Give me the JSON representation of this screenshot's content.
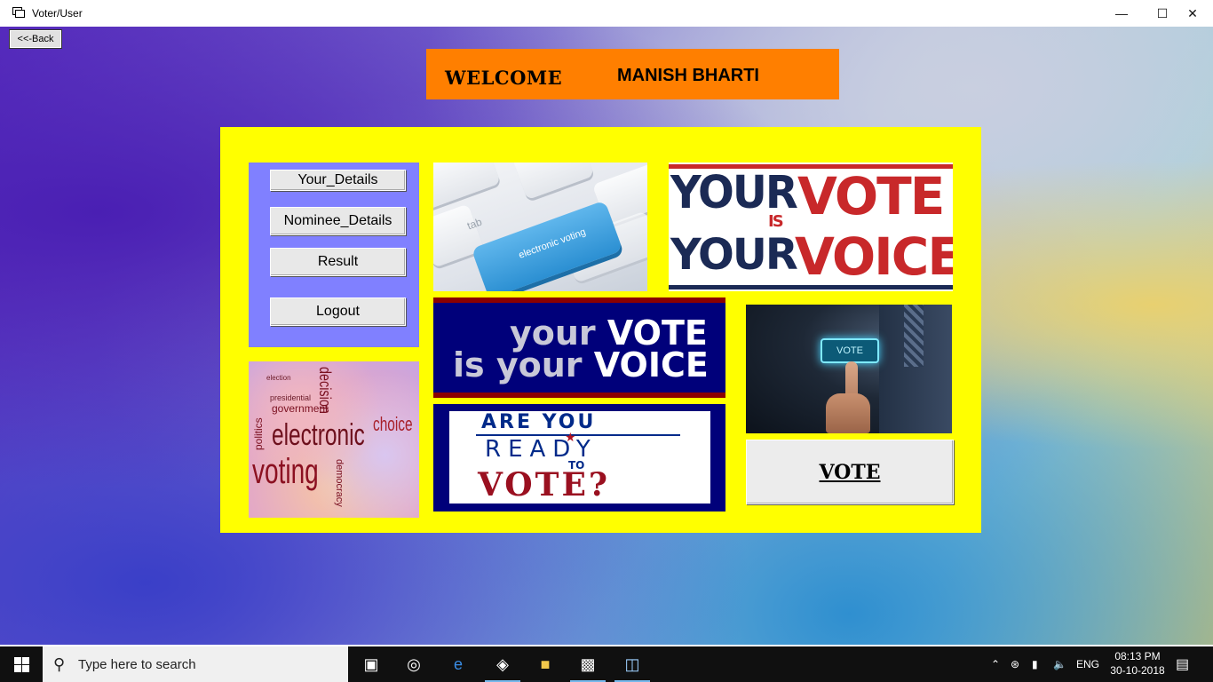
{
  "window": {
    "title": "Voter/User"
  },
  "back_button": {
    "label": "<<-Back"
  },
  "welcome": {
    "word": "WELCOME",
    "name": "MANISH BHARTI"
  },
  "menu": {
    "items": [
      {
        "label": "Your_Details"
      },
      {
        "label": "Nominee_Details"
      },
      {
        "label": "Result"
      },
      {
        "label": "Logout"
      }
    ]
  },
  "images": {
    "keyboard": {
      "tab": "tab",
      "key_text": "electronic voting"
    },
    "your_vote_your_voice": {
      "your": "YOUR",
      "vote": "VOTE",
      "is": "IS",
      "your2": "YOUR",
      "voice": "VOICE"
    },
    "banner": {
      "line1_a": "your ",
      "line1_b": "VOTE",
      "line2_a": "is your ",
      "line2_b": "VOICE"
    },
    "hand": {
      "chip": "VOTE"
    },
    "cloud": {
      "w1": "electronic",
      "w2": "voting",
      "w3": "choice",
      "w4": "decision",
      "w5": "politics",
      "w6": "government",
      "w7": "democracy",
      "w8": "election",
      "w9": "presidential"
    },
    "ready": {
      "line1": "ARE YOU",
      "line2": "READY",
      "line3": "TO",
      "line4": "VOTE?"
    }
  },
  "vote_button": {
    "label": "VOTE"
  },
  "taskbar": {
    "search_placeholder": "Type here to search",
    "language": "ENG",
    "time": "08:13 PM",
    "date": "30-10-2018"
  }
}
